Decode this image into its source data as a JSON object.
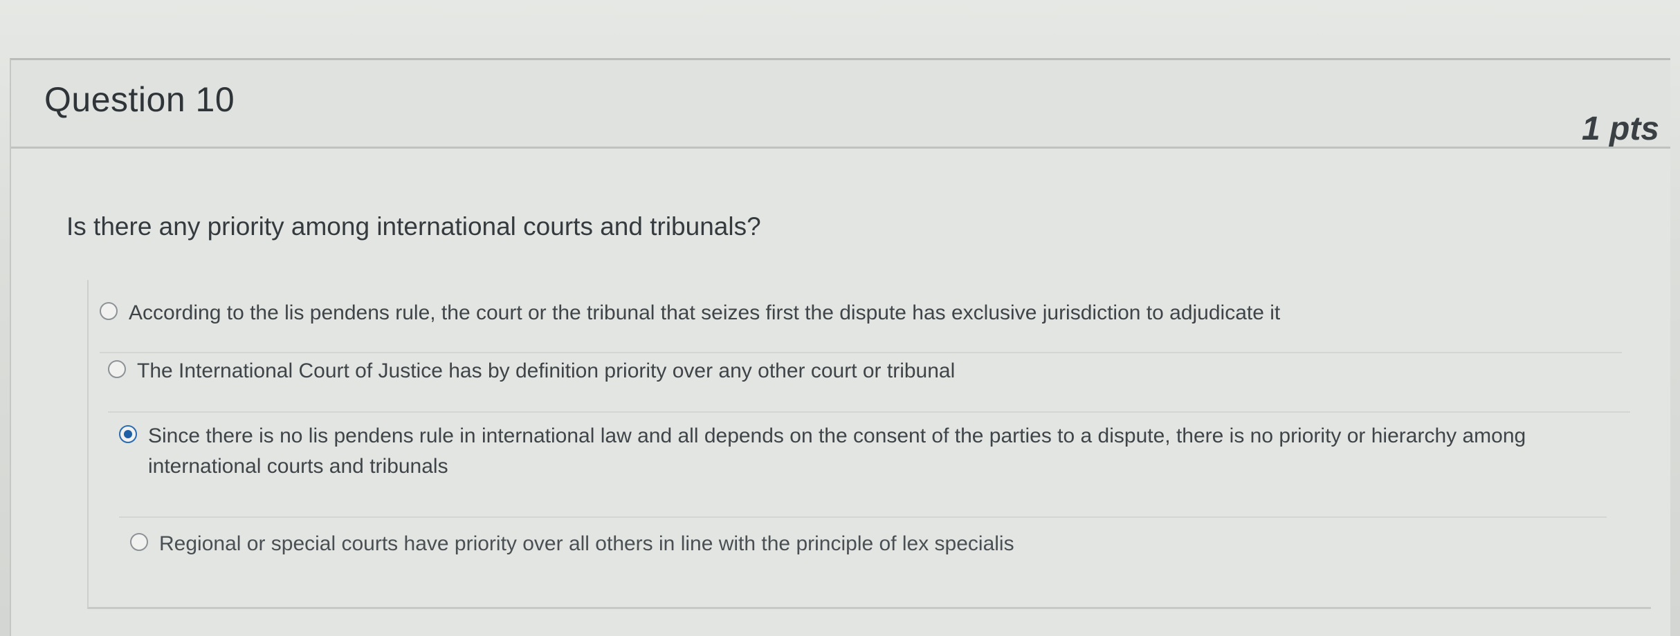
{
  "question": {
    "title": "Question 10",
    "points": "1 pts",
    "text": "Is there any priority among international courts and tribunals?",
    "answers": [
      {
        "label": "According to the lis pendens rule, the court or the tribunal that seizes first the dispute has exclusive jurisdiction to adjudicate it",
        "selected": false
      },
      {
        "label": "The International Court of Justice has by definition priority over any other court or tribunal",
        "selected": false
      },
      {
        "label": "Since there is no lis pendens rule in international law and all depends on the consent of the parties to a dispute, there is no priority or hierarchy among international courts and tribunals",
        "selected": true
      },
      {
        "label": "Regional or special courts have priority over all others in line with the principle of lex specialis",
        "selected": false
      }
    ]
  },
  "colors": {
    "accent": "#1f5fa6",
    "card_background": "#e3e5e2"
  }
}
